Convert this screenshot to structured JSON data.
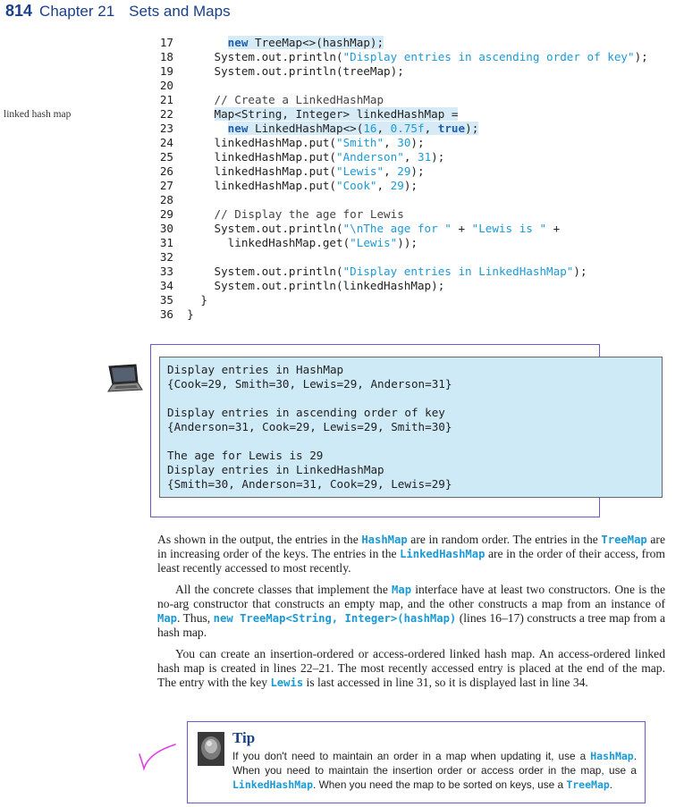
{
  "header": {
    "page_number": "814",
    "chapter": "Chapter 21",
    "title": "Sets and Maps"
  },
  "margin_note": "linked hash map",
  "code_lines": [
    {
      "num": "17",
      "indent": "      ",
      "hl": true,
      "tokens": [
        {
          "t": "new",
          "c": "kw"
        },
        {
          "t": " TreeMap<>(hashMap);",
          "c": ""
        }
      ]
    },
    {
      "num": "18",
      "indent": "    ",
      "hl": false,
      "tokens": [
        {
          "t": "System.out.println(",
          "c": ""
        },
        {
          "t": "\"Display entries in ascending order of key\"",
          "c": "str"
        },
        {
          "t": ");",
          "c": ""
        }
      ]
    },
    {
      "num": "19",
      "indent": "    ",
      "hl": false,
      "tokens": [
        {
          "t": "System.out.println(treeMap);",
          "c": ""
        }
      ]
    },
    {
      "num": "20",
      "indent": "",
      "hl": false,
      "tokens": []
    },
    {
      "num": "21",
      "indent": "    ",
      "hl": false,
      "tokens": [
        {
          "t": "// Create a LinkedHashMap",
          "c": "com"
        }
      ]
    },
    {
      "num": "22",
      "indent": "    ",
      "hl": true,
      "tokens": [
        {
          "t": "Map<String, Integer> linkedHashMap =",
          "c": ""
        }
      ]
    },
    {
      "num": "23",
      "indent": "      ",
      "hl": true,
      "tokens": [
        {
          "t": "new",
          "c": "kw"
        },
        {
          "t": " LinkedHashMap<>(",
          "c": ""
        },
        {
          "t": "16",
          "c": "str"
        },
        {
          "t": ", ",
          "c": ""
        },
        {
          "t": "0.75f",
          "c": "str"
        },
        {
          "t": ", ",
          "c": ""
        },
        {
          "t": "true",
          "c": "kw"
        },
        {
          "t": ");",
          "c": ""
        }
      ]
    },
    {
      "num": "24",
      "indent": "    ",
      "hl": false,
      "tokens": [
        {
          "t": "linkedHashMap.put(",
          "c": ""
        },
        {
          "t": "\"Smith\"",
          "c": "str"
        },
        {
          "t": ", ",
          "c": ""
        },
        {
          "t": "30",
          "c": "str"
        },
        {
          "t": ");",
          "c": ""
        }
      ]
    },
    {
      "num": "25",
      "indent": "    ",
      "hl": false,
      "tokens": [
        {
          "t": "linkedHashMap.put(",
          "c": ""
        },
        {
          "t": "\"Anderson\"",
          "c": "str"
        },
        {
          "t": ", ",
          "c": ""
        },
        {
          "t": "31",
          "c": "str"
        },
        {
          "t": ");",
          "c": ""
        }
      ]
    },
    {
      "num": "26",
      "indent": "    ",
      "hl": false,
      "tokens": [
        {
          "t": "linkedHashMap.put(",
          "c": ""
        },
        {
          "t": "\"Lewis\"",
          "c": "str"
        },
        {
          "t": ", ",
          "c": ""
        },
        {
          "t": "29",
          "c": "str"
        },
        {
          "t": ");",
          "c": ""
        }
      ]
    },
    {
      "num": "27",
      "indent": "    ",
      "hl": false,
      "tokens": [
        {
          "t": "linkedHashMap.put(",
          "c": ""
        },
        {
          "t": "\"Cook\"",
          "c": "str"
        },
        {
          "t": ", ",
          "c": ""
        },
        {
          "t": "29",
          "c": "str"
        },
        {
          "t": ");",
          "c": ""
        }
      ]
    },
    {
      "num": "28",
      "indent": "",
      "hl": false,
      "tokens": []
    },
    {
      "num": "29",
      "indent": "    ",
      "hl": false,
      "tokens": [
        {
          "t": "// Display the age for Lewis",
          "c": "com"
        }
      ]
    },
    {
      "num": "30",
      "indent": "    ",
      "hl": false,
      "tokens": [
        {
          "t": "System.out.println(",
          "c": ""
        },
        {
          "t": "\"\\nThe age for \"",
          "c": "str"
        },
        {
          "t": " + ",
          "c": ""
        },
        {
          "t": "\"Lewis is \"",
          "c": "str"
        },
        {
          "t": " +",
          "c": ""
        }
      ]
    },
    {
      "num": "31",
      "indent": "      ",
      "hl": false,
      "tokens": [
        {
          "t": "linkedHashMap.get(",
          "c": ""
        },
        {
          "t": "\"Lewis\"",
          "c": "str"
        },
        {
          "t": "));",
          "c": ""
        }
      ]
    },
    {
      "num": "32",
      "indent": "",
      "hl": false,
      "tokens": []
    },
    {
      "num": "33",
      "indent": "    ",
      "hl": false,
      "tokens": [
        {
          "t": "System.out.println(",
          "c": ""
        },
        {
          "t": "\"Display entries in LinkedHashMap\"",
          "c": "str"
        },
        {
          "t": ");",
          "c": ""
        }
      ]
    },
    {
      "num": "34",
      "indent": "    ",
      "hl": false,
      "tokens": [
        {
          "t": "System.out.println(linkedHashMap);",
          "c": ""
        }
      ]
    },
    {
      "num": "35",
      "indent": "  ",
      "hl": false,
      "tokens": [
        {
          "t": "}",
          "c": ""
        }
      ]
    },
    {
      "num": "36",
      "indent": "",
      "hl": false,
      "tokens": [
        {
          "t": "}",
          "c": ""
        }
      ]
    }
  ],
  "output": {
    "lines": [
      "Display entries in HashMap",
      "{Cook=29, Smith=30, Lewis=29, Anderson=31}",
      "",
      "Display entries in ascending order of key",
      "{Anderson=31, Cook=29, Lewis=29, Smith=30}",
      "",
      "The age for Lewis is 29",
      "Display entries in LinkedHashMap",
      "{Smith=30, Anderson=31, Cook=29, Lewis=29}"
    ]
  },
  "paragraphs": [
    [
      {
        "t": "As shown in the output, the entries in the "
      },
      {
        "t": "HashMap",
        "code": true
      },
      {
        "t": " are in random order. The entries in the "
      },
      {
        "t": "TreeMap",
        "code": true
      },
      {
        "t": " are in increasing order of the keys. The entries in the "
      },
      {
        "t": "LinkedHashMap",
        "code": true
      },
      {
        "t": " are in the order of their access, from least recently accessed to most recently."
      }
    ],
    [
      {
        "t": "All the concrete classes that implement the "
      },
      {
        "t": "Map",
        "code": true
      },
      {
        "t": " interface have at least two constructors. One is the no-arg constructor that constructs an empty map, and the other constructs a map from an instance of "
      },
      {
        "t": "Map",
        "code": true
      },
      {
        "t": ". Thus, "
      },
      {
        "t": "new TreeMap<String, Integer>(hashMap)",
        "code": true
      },
      {
        "t": " (lines 16–17) constructs a tree map from a hash map."
      }
    ],
    [
      {
        "t": "You can create an insertion-ordered or access-ordered linked hash map. An access-ordered linked hash map is created in lines 22–21. The most recently accessed entry is placed at the end of the map. The entry with the key "
      },
      {
        "t": "Lewis",
        "code": true
      },
      {
        "t": " is last accessed in line 31, so it is displayed last in line 34."
      }
    ]
  ],
  "tip": {
    "title": "Tip",
    "text": [
      {
        "t": "If you don't need to maintain an order in a map when updating it, use a "
      },
      {
        "t": "HashMap",
        "code": true
      },
      {
        "t": ". When you need to maintain the insertion order or access order in the map, use a "
      },
      {
        "t": "LinkedHashMap",
        "code": true
      },
      {
        "t": ". When you need the map to be sorted on keys, use a "
      },
      {
        "t": "TreeMap",
        "code": true
      },
      {
        "t": "."
      }
    ]
  },
  "icons": {
    "laptop": "laptop-icon",
    "tip": "tip-icon",
    "check": "check-mark-icon"
  },
  "colors": {
    "accent": "#1a3f8a",
    "code_string": "#1a9ad6",
    "keyword": "#1f5fb0",
    "output_bg": "#cfeaf7",
    "frame": "#6a5acd",
    "check": "#e040e0"
  }
}
